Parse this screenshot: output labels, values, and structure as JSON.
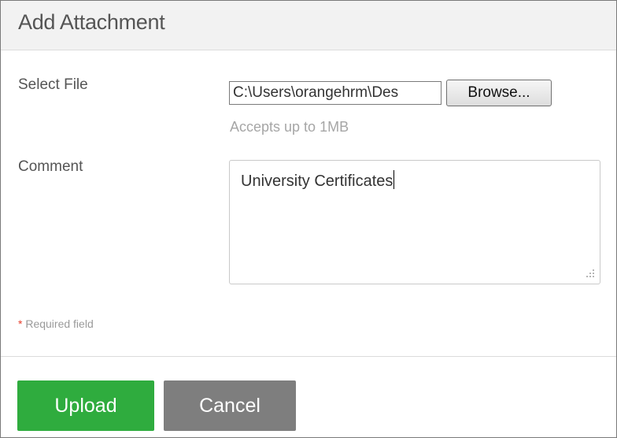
{
  "dialog": {
    "title": "Add Attachment"
  },
  "form": {
    "select_file_label": "Select File",
    "file_path_value": "C:\\Users\\orangehrm\\Des",
    "browse_label": "Browse...",
    "file_hint": "Accepts up to 1MB",
    "comment_label": "Comment",
    "comment_value": "University Certificates",
    "required_star": "*",
    "required_text": " Required field"
  },
  "actions": {
    "upload_label": "Upload",
    "cancel_label": "Cancel"
  },
  "colors": {
    "upload_button": "#2fac3e",
    "cancel_button": "#7e7e7e",
    "required_star": "#e8402e"
  },
  "icons": {
    "resize_grip": "resize-grip-icon"
  }
}
